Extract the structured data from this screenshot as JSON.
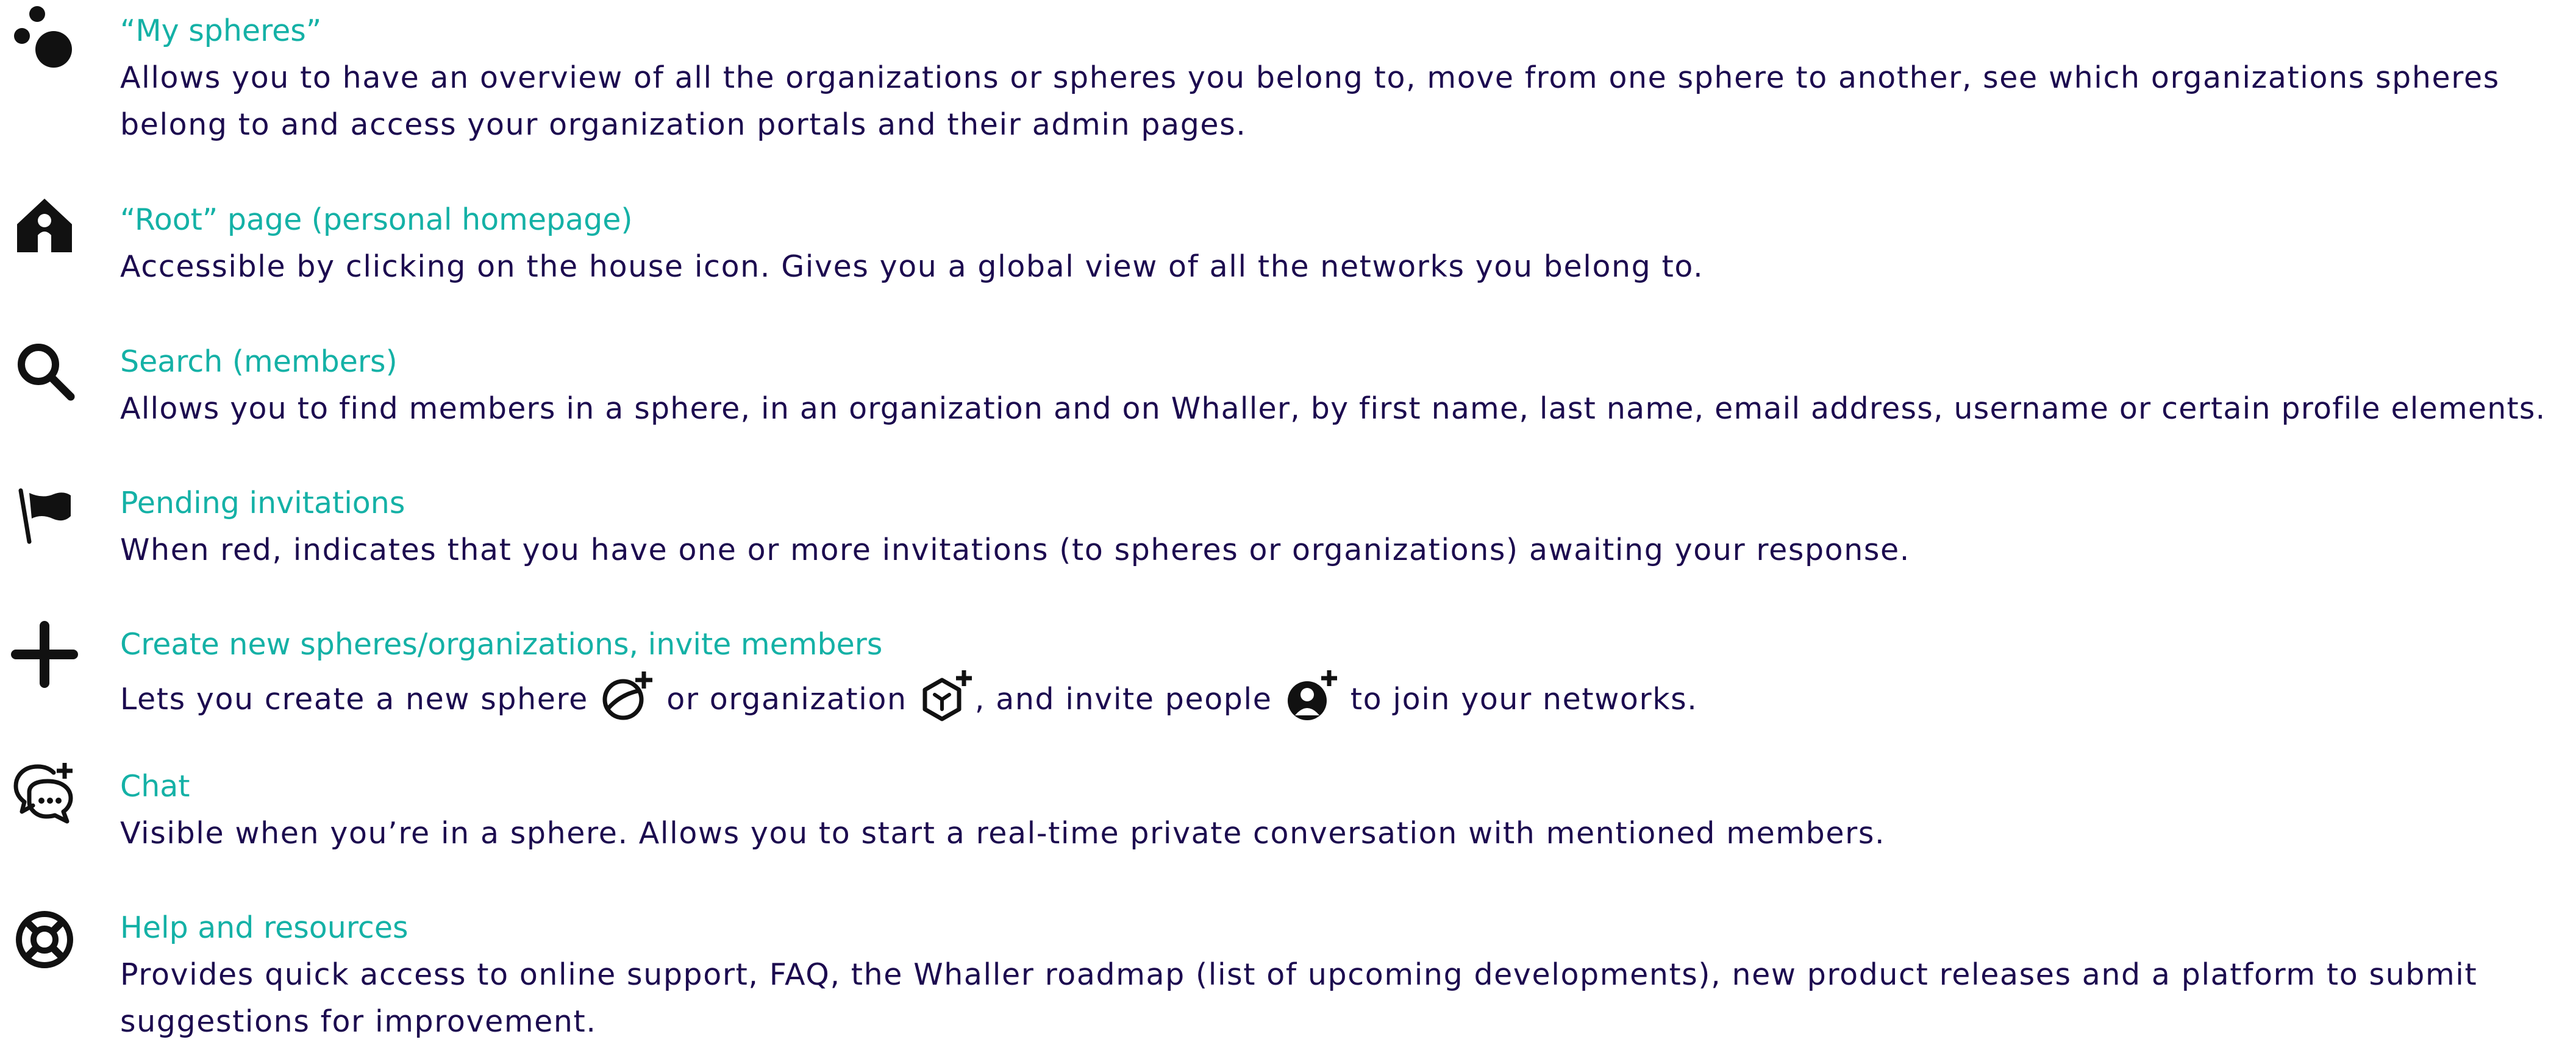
{
  "items": [
    {
      "icon": "spheres-icon",
      "title": "“My spheres”",
      "description": "Allows you to have an overview of all the organizations or spheres you belong to, move from one sphere to another, see which organizations spheres belong to and access your organization portals and their admin pages."
    },
    {
      "icon": "house-icon",
      "title": "“Root” page (personal homepage)",
      "description": "Accessible by clicking on the house icon. Gives you a global view of all the networks you belong to."
    },
    {
      "icon": "search-icon",
      "title": "Search (members)",
      "description": "Allows you to find members in a sphere, in an organization and on Whaller, by first name, last name, email address, username or certain profile elements."
    },
    {
      "icon": "flag-icon",
      "title": "Pending invitations",
      "description": "When red, indicates that you have one or more invitations (to spheres or organizations) awaiting your response."
    },
    {
      "icon": "plus-icon",
      "title": "Create new spheres/organizations, invite members",
      "description_parts": {
        "part1": "Lets you create a new sphere ",
        "part2": " or organization ",
        "part3": ", and invite people ",
        "part4": " to join your networks."
      },
      "inline_icons": [
        "new-sphere-icon",
        "new-organization-icon",
        "invite-member-icon"
      ]
    },
    {
      "icon": "chat-icon",
      "title": "Chat",
      "description": "Visible when you’re in a sphere. Allows you to start a real-time private conversation with mentioned members."
    },
    {
      "icon": "lifebuoy-icon",
      "title": "Help and resources",
      "description": "Provides quick access to online support, FAQ, the Whaller roadmap (list of upcoming developments), new product releases and a platform to submit suggestions for improvement."
    }
  ],
  "colors": {
    "title": "#14b1a6",
    "text": "#1c0b4f",
    "icon": "#111111"
  }
}
